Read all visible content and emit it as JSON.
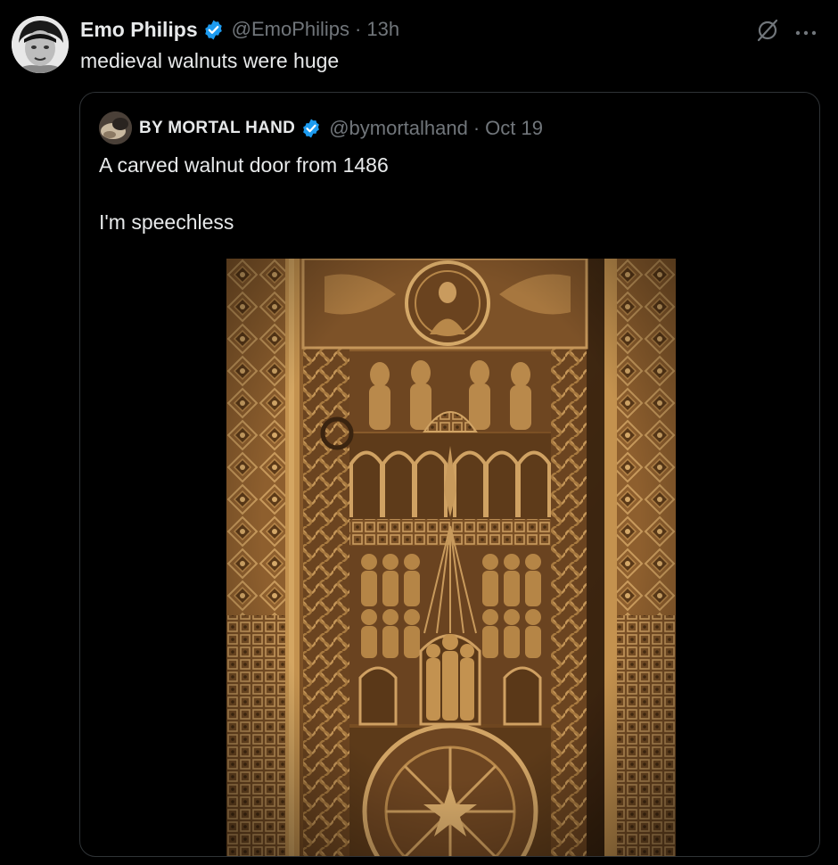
{
  "tweet": {
    "author_name": "Emo Philips",
    "handle": "@EmoPhilips",
    "separator": "·",
    "time": "13h",
    "text": "medieval walnuts were huge",
    "verified_color": "#1d9bf0"
  },
  "quoted_tweet": {
    "author_name": "BY MORTAL HAND",
    "handle": "@bymortalhand",
    "separator": "·",
    "time": "Oct 19",
    "line1": "A carved walnut door from 1486",
    "line2": "I'm speechless",
    "image_subject": "carved walnut door"
  },
  "icons": {
    "grok": "grok-icon",
    "more": "more-icon",
    "verified": "verified-badge-icon"
  },
  "colors": {
    "background": "#000000",
    "text_primary": "#e7e9ea",
    "text_secondary": "#71767b",
    "border": "#2f3336",
    "wood": "#8a5a2b"
  }
}
